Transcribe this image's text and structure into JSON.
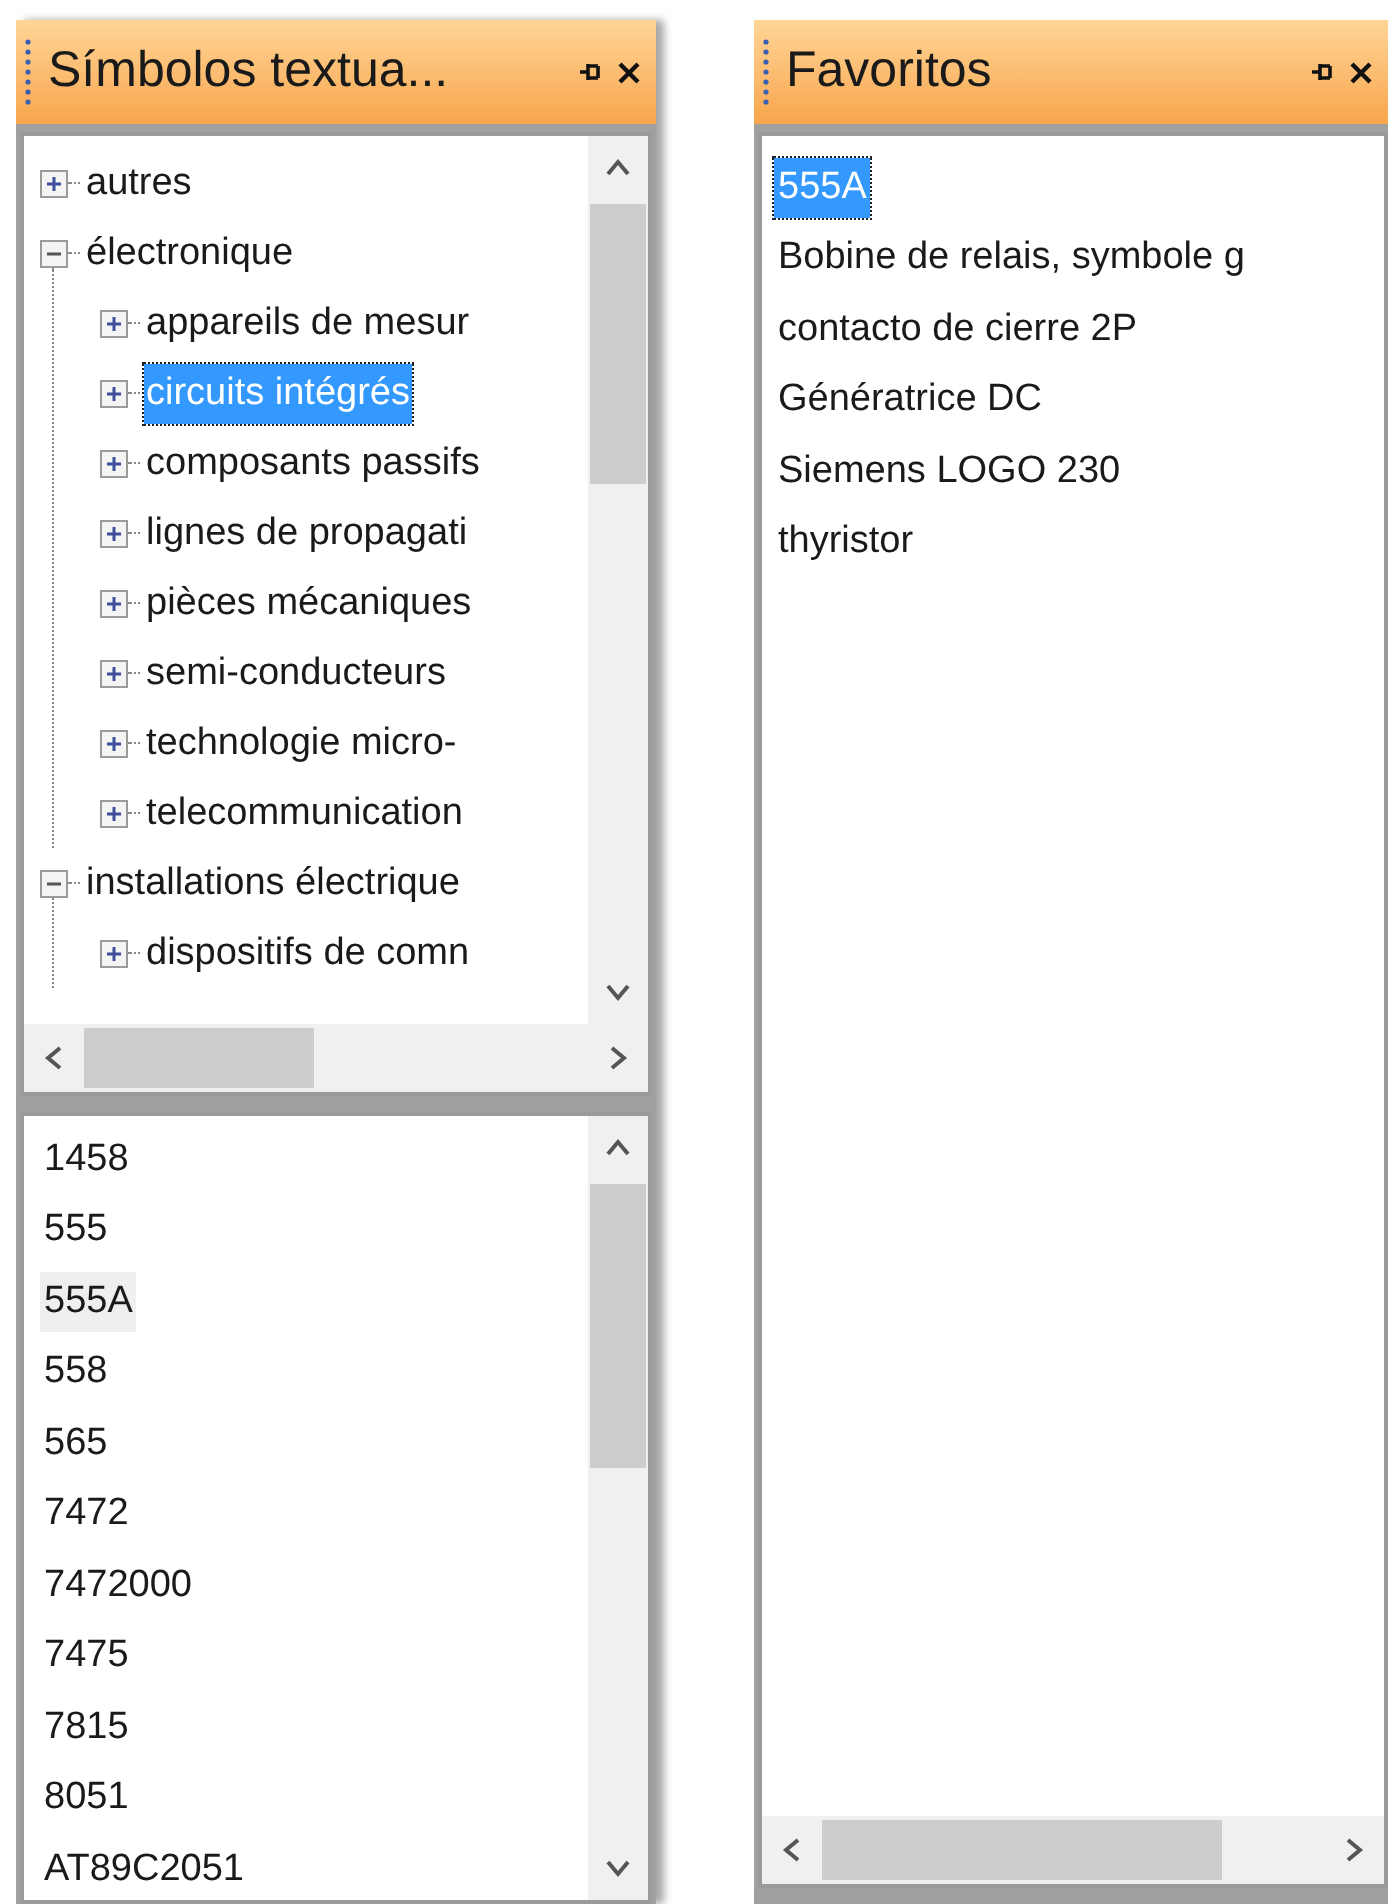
{
  "symbols_panel": {
    "title": "Símbolos textua...",
    "tree": [
      {
        "label": "autres",
        "expanded": false,
        "selected": false
      },
      {
        "label": "électronique",
        "expanded": true,
        "selected": false,
        "children": [
          {
            "label": "appareils de mesur",
            "expanded": false,
            "selected": false
          },
          {
            "label": "circuits intégrés",
            "expanded": false,
            "selected": true
          },
          {
            "label": "composants passifs",
            "expanded": false,
            "selected": false
          },
          {
            "label": "lignes de propagati",
            "expanded": false,
            "selected": false
          },
          {
            "label": "pièces mécaniques",
            "expanded": false,
            "selected": false
          },
          {
            "label": "semi-conducteurs",
            "expanded": false,
            "selected": false
          },
          {
            "label": "technologie micro-",
            "expanded": false,
            "selected": false
          },
          {
            "label": "telecommunication",
            "expanded": false,
            "selected": false
          }
        ]
      },
      {
        "label": "installations électrique",
        "expanded": true,
        "selected": false,
        "children": [
          {
            "label": "dispositifs de comn",
            "expanded": false,
            "selected": false
          }
        ]
      }
    ],
    "list": [
      {
        "label": "1458",
        "selected": false
      },
      {
        "label": "555",
        "selected": false
      },
      {
        "label": "555A",
        "selected": true
      },
      {
        "label": "558",
        "selected": false
      },
      {
        "label": "565",
        "selected": false
      },
      {
        "label": "7472",
        "selected": false
      },
      {
        "label": "7472000",
        "selected": false
      },
      {
        "label": "7475",
        "selected": false
      },
      {
        "label": "7815",
        "selected": false
      },
      {
        "label": "8051",
        "selected": false
      },
      {
        "label": "AT89C2051",
        "selected": false
      }
    ]
  },
  "favorites_panel": {
    "title": "Favoritos",
    "list": [
      {
        "label": "555A",
        "selected": true
      },
      {
        "label": "Bobine de relais, symbole g",
        "selected": false
      },
      {
        "label": "contacto de cierre 2P",
        "selected": false
      },
      {
        "label": "Génératrice DC",
        "selected": false
      },
      {
        "label": "Siemens LOGO 230",
        "selected": false
      },
      {
        "label": "thyristor",
        "selected": false
      }
    ]
  }
}
